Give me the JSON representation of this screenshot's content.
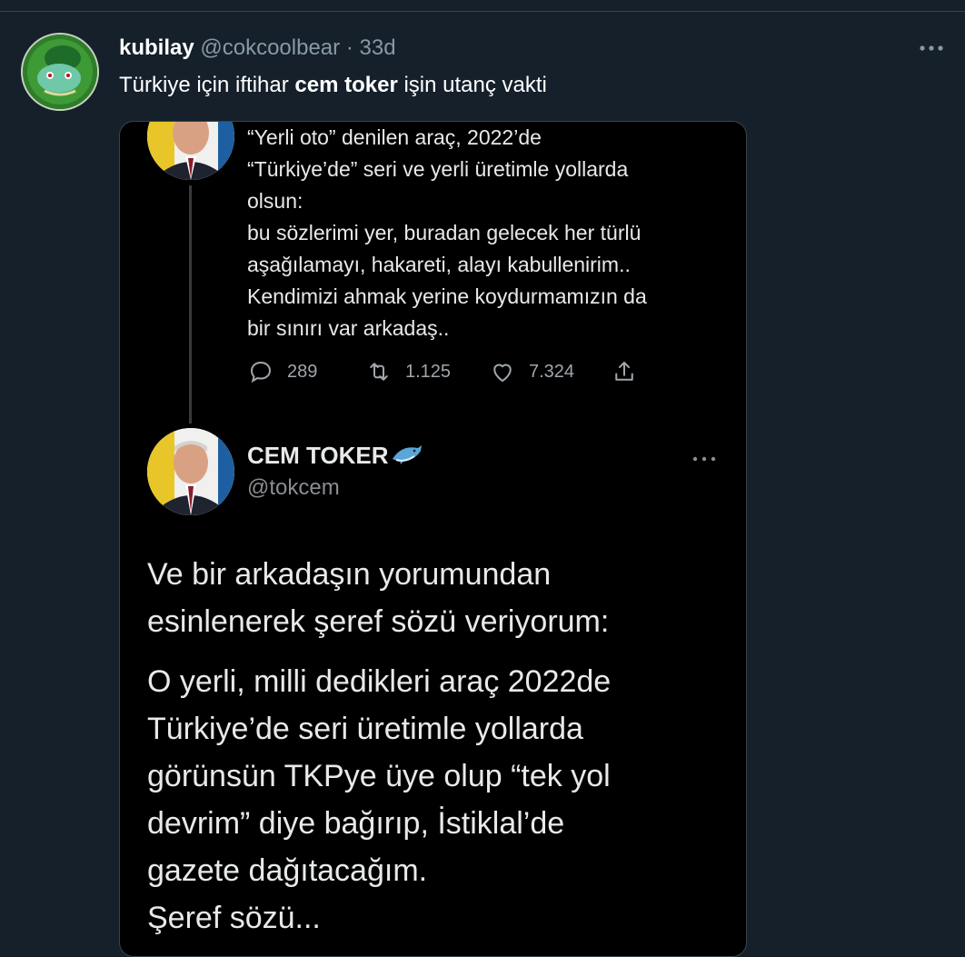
{
  "tweet": {
    "display_name": "kubilay",
    "handle": "@cokcoolbear",
    "separator": "·",
    "time": "33d",
    "text_before": "Türkiye için iftihar ",
    "text_bold": "cem toker",
    "text_after": " işin utanç vakti"
  },
  "quoted": {
    "lines": [
      "“Yerli oto” denilen araç, 2022’de",
      "“Türkiye’de” seri ve yerli üretimle yollarda",
      "olsun:",
      "bu sözlerimi yer, buradan gelecek her türlü",
      "aşağılamayı, hakareti, alayı kabullenirim..",
      "Kendimizi ahmak yerine koydurmamızın da",
      "bir sınırı var arkadaş.."
    ],
    "replies": "289",
    "retweets": "1.125",
    "likes": "7.324"
  },
  "reply": {
    "name": "CEM TOKER",
    "handle": "@tokcem",
    "para1": [
      "Ve bir arkadaşın yorumundan",
      "esinlenerek şeref sözü veriyorum:"
    ],
    "para2": [
      "O yerli, milli dedikleri araç 2022de",
      "Türkiye’de seri üretimle yollarda",
      "görünsün TKPye üye olup “tek yol",
      "devrim” diye bağırıp, İstiklal’de",
      "gazete dağıtacağım.",
      "Şeref sözü..."
    ]
  },
  "icons": {
    "more": "more-icon",
    "reply": "reply-icon",
    "retweet": "retweet-icon",
    "like": "heart-icon",
    "share": "share-icon",
    "dolphin": "dolphin-emoji-icon"
  },
  "colors": {
    "background": "#15202b",
    "secondary_text": "#8899a6",
    "media_background": "#000000"
  }
}
